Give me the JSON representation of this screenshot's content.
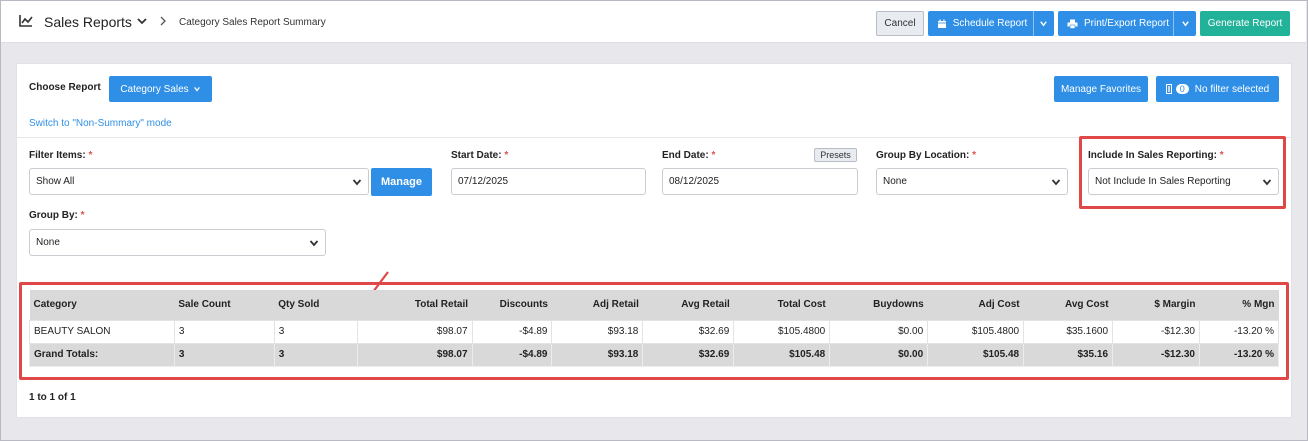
{
  "header": {
    "title": "Sales Reports",
    "breadcrumb": "Category Sales Report Summary",
    "cancel_label": "Cancel",
    "schedule_label": "Schedule Report",
    "print_label": "Print/Export Report",
    "generate_label": "Generate Report"
  },
  "toolbar": {
    "choose_report_label": "Choose Report",
    "report_value": "Category Sales",
    "mode_link": "Switch to \"Non-Summary\" mode",
    "favorites_label": "Manage Favorites",
    "filter_count": "0",
    "filter_label": "No filter selected"
  },
  "filters": {
    "filter_items_label": "Filter Items:",
    "filter_items_value": "Show All",
    "manage_label": "Manage",
    "start_date_label": "Start Date:",
    "start_date_value": "07/12/2025",
    "end_date_label": "End Date:",
    "end_date_value": "08/12/2025",
    "presets_label": "Presets",
    "group_by_location_label": "Group By Location:",
    "group_by_location_value": "None",
    "include_label": "Include In Sales Reporting:",
    "include_value": "Not Include In Sales Reporting",
    "group_by_label": "Group By:",
    "group_by_value": "None",
    "required_mark": "*"
  },
  "table": {
    "columns": [
      "Category",
      "Sale Count",
      "Qty Sold",
      "Total Retail",
      "Discounts",
      "Adj Retail",
      "Avg Retail",
      "Total Cost",
      "Buydowns",
      "Adj Cost",
      "Avg Cost",
      "$ Margin",
      "% Mgn"
    ],
    "rows": [
      [
        "BEAUTY SALON",
        "3",
        "3",
        "$98.07",
        "-$4.89",
        "$93.18",
        "$32.69",
        "$105.4800",
        "$0.00",
        "$105.4800",
        "$35.1600",
        "-$12.30",
        "-13.20 %"
      ]
    ],
    "totals": [
      "Grand Totals:",
      "3",
      "3",
      "$98.07",
      "-$4.89",
      "$93.18",
      "$32.69",
      "$105.48",
      "$0.00",
      "$105.48",
      "$35.16",
      "-$12.30",
      "-13.20 %"
    ]
  },
  "pagination": "1 to 1 of 1",
  "colors": {
    "primary": "#2f8fe6",
    "success": "#22b29a",
    "highlight": "#e04848"
  }
}
